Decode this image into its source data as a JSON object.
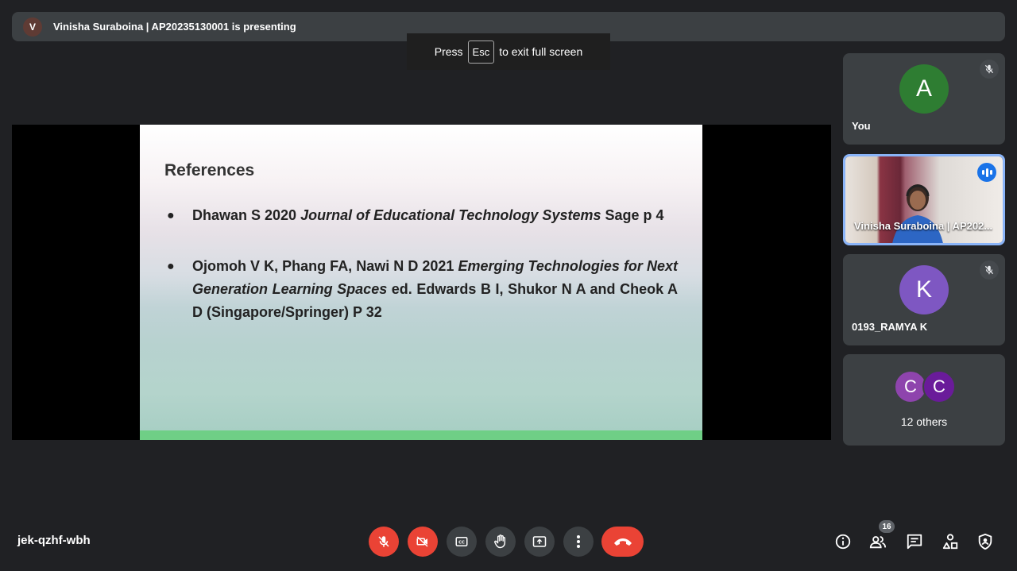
{
  "presenter": {
    "avatar_letter": "V",
    "text": "Vinisha Suraboina | AP20235130001 is presenting"
  },
  "fullscreen_toast": {
    "press": "Press",
    "key": "Esc",
    "rest": "to exit full screen"
  },
  "slide": {
    "title": "References",
    "refs": [
      {
        "plain": "Dhawan S 2020 ",
        "italic": "Journal of Educational Technology Systems",
        "tail": " Sage p 4"
      },
      {
        "plain": "Ojomoh V K, Phang FA, Nawi N D 2021 ",
        "italic": "Emerging Technologies for Next Generation Learning Spaces",
        "tail": " ed. Edwards B I, Shukor N A and Cheok A D (Singapore/Springer) P 32"
      }
    ]
  },
  "participants": [
    {
      "name": "You",
      "letter": "A",
      "color": "#2e7d32",
      "muted": true
    },
    {
      "name": "Vinisha Suraboina | AP202...",
      "video": true,
      "speaking": true
    },
    {
      "name": "0193_RAMYA K",
      "letter": "K",
      "color": "#7e57c2",
      "muted": true
    }
  ],
  "others": {
    "letters": [
      "C",
      "C"
    ],
    "colors": [
      "#8e44ad",
      "#6a1b9a"
    ],
    "label": "12 others"
  },
  "meeting_code": "jek-qzhf-wbh",
  "participant_count": "16",
  "colors": {
    "background": "#202124",
    "tile": "#3c4043",
    "danger": "#ea4335",
    "accent": "#8ab4f8"
  },
  "controls": [
    "mic-off-icon",
    "camera-off-icon",
    "captions-icon",
    "raise-hand-icon",
    "present-icon",
    "more-options-icon",
    "end-call-icon"
  ],
  "right_controls": [
    "info-icon",
    "people-icon",
    "chat-icon",
    "activities-icon",
    "host-controls-icon"
  ]
}
